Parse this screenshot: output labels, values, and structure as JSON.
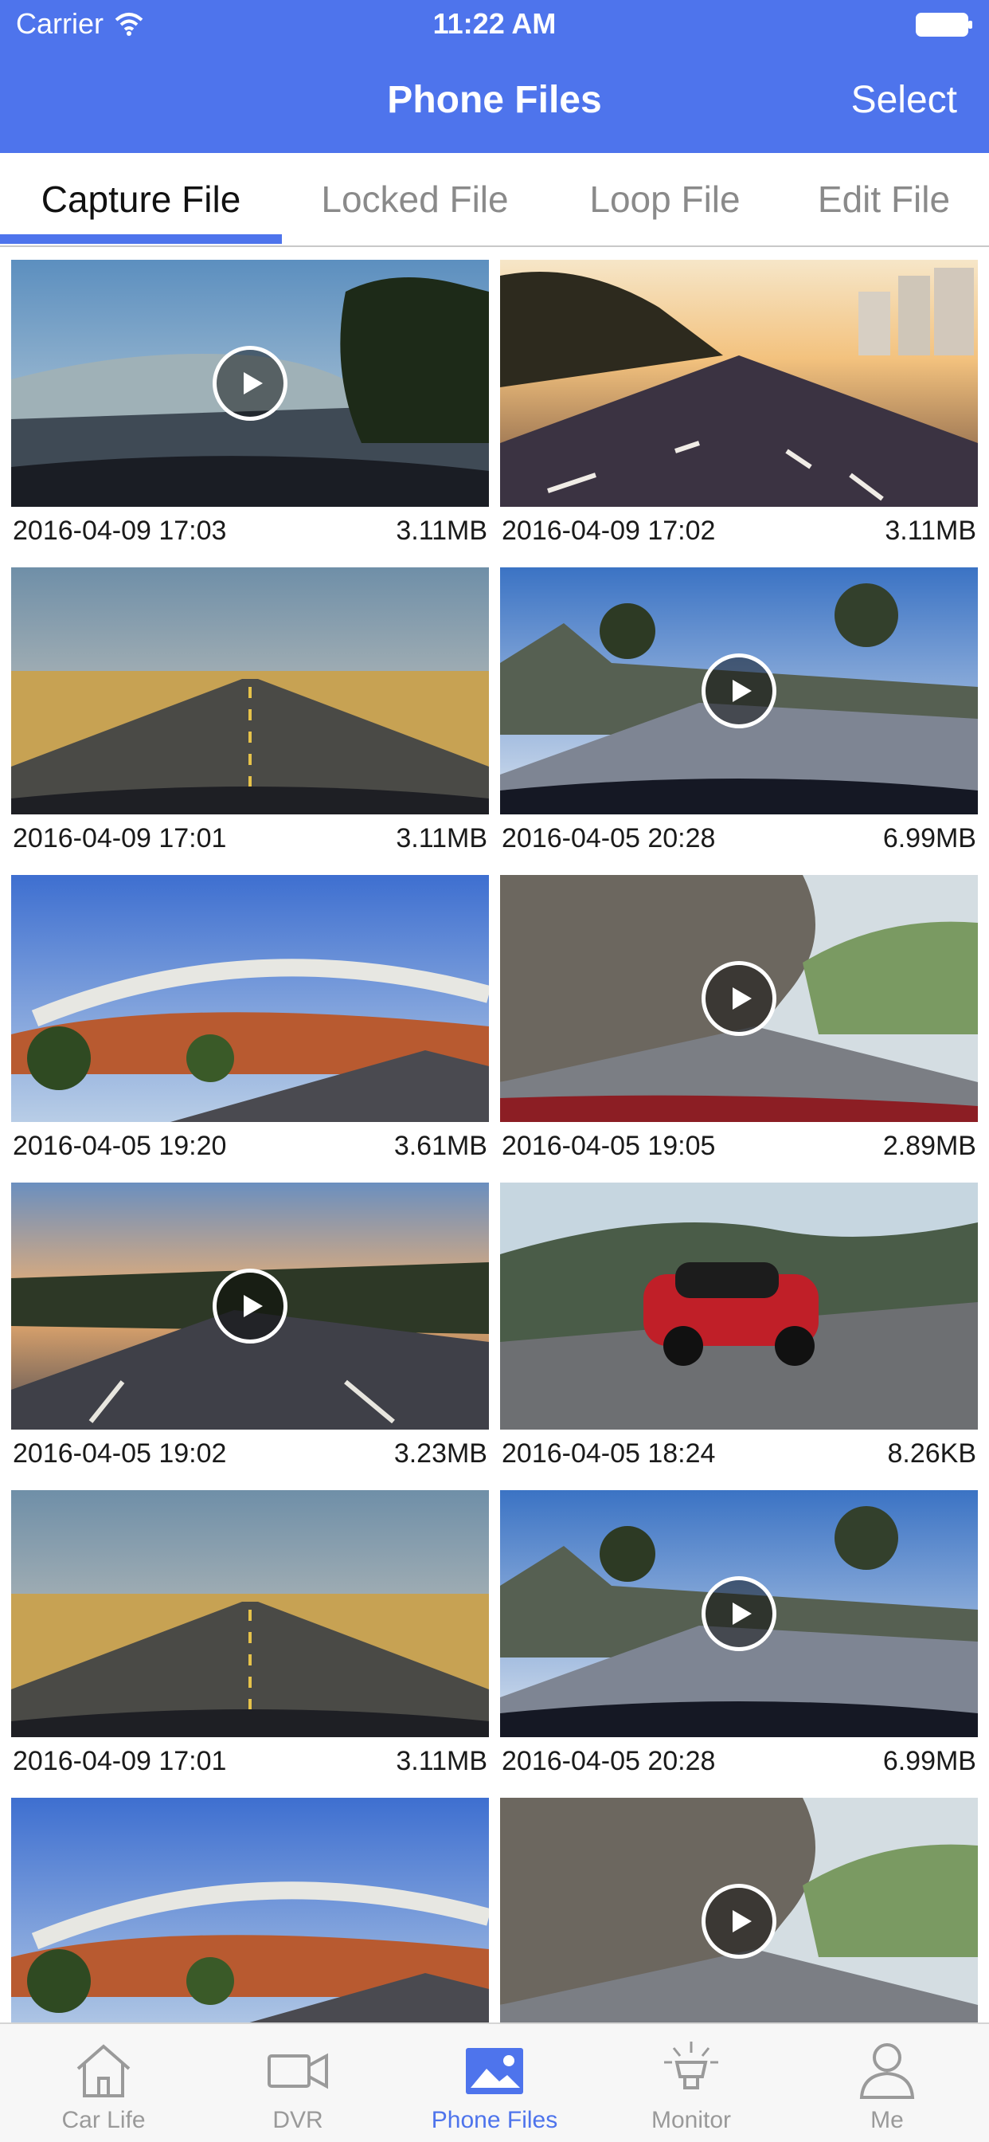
{
  "status_bar": {
    "carrier": "Carrier",
    "time": "11:22 AM",
    "icons": [
      "wifi-icon",
      "battery-icon"
    ]
  },
  "nav": {
    "title": "Phone Files",
    "select_label": "Select"
  },
  "tabs": [
    {
      "label": "Capture File",
      "active": true
    },
    {
      "label": "Locked File",
      "active": false
    },
    {
      "label": "Loop File",
      "active": false
    },
    {
      "label": "Edit File",
      "active": false
    }
  ],
  "files": [
    {
      "date": "2016-04-09 17:03",
      "size": "3.11MB",
      "video": true
    },
    {
      "date": "2016-04-09 17:02",
      "size": "3.11MB",
      "video": false
    },
    {
      "date": "2016-04-09 17:01",
      "size": "3.11MB",
      "video": false
    },
    {
      "date": "2016-04-05 20:28",
      "size": "6.99MB",
      "video": true
    },
    {
      "date": "2016-04-05 19:20",
      "size": "3.61MB",
      "video": false
    },
    {
      "date": "2016-04-05 19:05",
      "size": "2.89MB",
      "video": true
    },
    {
      "date": "2016-04-05 19:02",
      "size": "3.23MB",
      "video": true
    },
    {
      "date": "2016-04-05 18:24",
      "size": "8.26KB",
      "video": false
    },
    {
      "date": "2016-04-09 17:01",
      "size": "3.11MB",
      "video": false
    },
    {
      "date": "2016-04-05 20:28",
      "size": "6.99MB",
      "video": true
    },
    {
      "date": "",
      "size": "",
      "video": false
    },
    {
      "date": "",
      "size": "",
      "video": true
    }
  ],
  "bottom_tabs": [
    {
      "label": "Car Life",
      "icon": "house-icon",
      "active": false
    },
    {
      "label": "DVR",
      "icon": "video-camera-icon",
      "active": false
    },
    {
      "label": "Phone Files",
      "icon": "photo-icon",
      "active": true
    },
    {
      "label": "Monitor",
      "icon": "lamp-icon",
      "active": false
    },
    {
      "label": "Me",
      "icon": "person-icon",
      "active": false
    }
  ],
  "colors": {
    "accent": "#4e74ec",
    "inactive_text": "#8a8a8a",
    "bottom_inactive": "#9a9a9a"
  }
}
